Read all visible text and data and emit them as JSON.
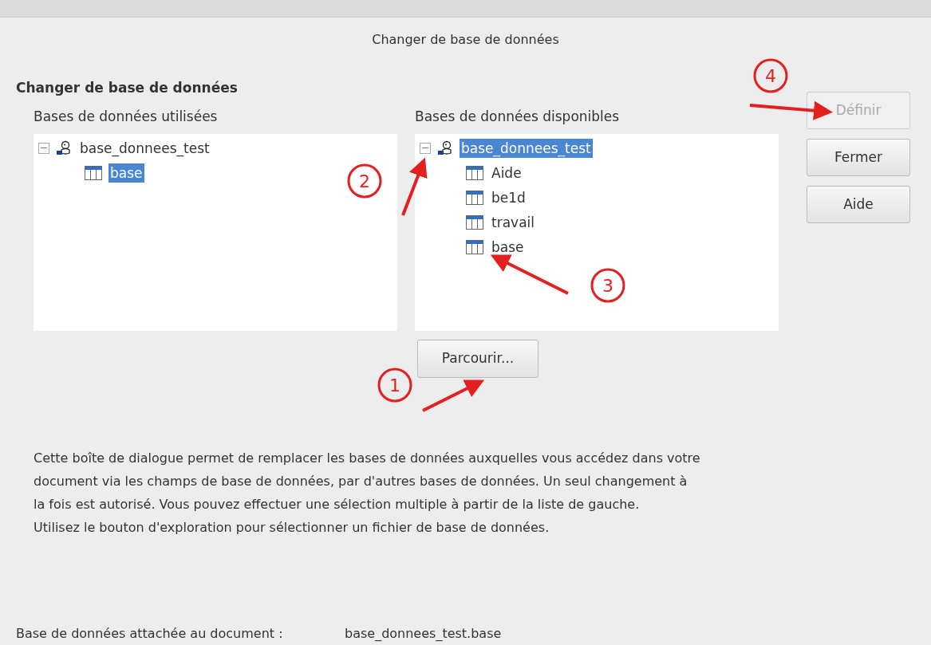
{
  "dialog": {
    "title": "Changer de base de données"
  },
  "section_title": "Changer de base de données",
  "used_list": {
    "label": "Bases de données utilisées",
    "items": [
      {
        "kind": "database",
        "label": "base_donnees_test",
        "expanded": true,
        "selected": false,
        "children": [
          {
            "kind": "table",
            "label": "base",
            "selected": true
          }
        ]
      }
    ]
  },
  "available_list": {
    "label": "Bases de données disponibles",
    "items": [
      {
        "kind": "database",
        "label": "base_donnees_test",
        "expanded": true,
        "selected": true,
        "children": [
          {
            "kind": "table",
            "label": "Aide",
            "selected": false
          },
          {
            "kind": "table",
            "label": "be1d",
            "selected": false
          },
          {
            "kind": "table",
            "label": "travail",
            "selected": false
          },
          {
            "kind": "table",
            "label": "base",
            "selected": false
          }
        ]
      }
    ]
  },
  "browse_button": {
    "label": "Parcourir..."
  },
  "side_buttons": [
    {
      "label": "Définir",
      "disabled": true
    },
    {
      "label": "Fermer",
      "disabled": false
    },
    {
      "label": "Aide",
      "disabled": false
    }
  ],
  "description": [
    "Cette boîte de dialogue permet de remplacer les bases de données auxquelles vous accédez dans votre document via les champs de base de données, par d'autres bases de données. Un seul changement à la fois est autorisé. Vous pouvez effectuer une sélection multiple à partir de la liste de gauche.",
    "Utilisez le bouton d'exploration pour sélectionner un fichier de base de données."
  ],
  "attached": {
    "label": "Base de données attachée au document :",
    "value": "base_donnees_test.base"
  },
  "annotations": [
    {
      "label": "1"
    },
    {
      "label": "2"
    },
    {
      "label": "3"
    },
    {
      "label": "4"
    }
  ]
}
